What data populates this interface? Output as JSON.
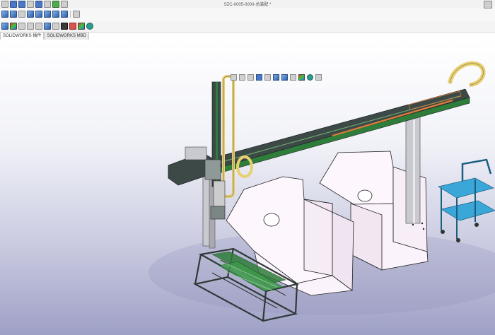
{
  "window": {
    "doc_title": "SZC-0005-0000-总装配 *"
  },
  "tabs": [
    {
      "label": "SOLIDWORKS 插件"
    },
    {
      "label": "SOLIDWORKS MBD"
    }
  ],
  "icons": {
    "quick_access": [
      "new-icon",
      "open-icon",
      "save-icon",
      "print-icon",
      "undo-icon",
      "select-icon",
      "rebuild-icon",
      "options-icon"
    ],
    "ribbon": [
      "view-orientation-icon",
      "shaded-icon",
      "wireframe-icon",
      "section-view-icon",
      "display-style-icon",
      "hide-show-icon",
      "edit-appearance-icon",
      "apply-scene-icon",
      "sketch-icon"
    ],
    "command_bar": [
      "appearance-icon",
      "rgb-icon",
      "lighting-icon",
      "camera-icon",
      "zoom-icon",
      "cube-icon",
      "section-icon",
      "dark-scene-icon",
      "decal-icon",
      "color-wheel-icon",
      "render-icon"
    ],
    "heads_up": [
      "zoom-to-fit-icon",
      "zoom-to-area-icon",
      "previous-view-icon",
      "section-view-icon",
      "dynamic-annotation-icon",
      "view-orientation-icon",
      "display-style-icon",
      "hide-show-items-icon",
      "edit-appearance-icon",
      "apply-scene-icon",
      "view-settings-icon"
    ]
  },
  "colors": {
    "part_white": "#fdf6fc",
    "frame_dark": "#2f3a38",
    "rail_green": "#2f7d3a",
    "cart_blue": "#3aa7d8",
    "hook_yellow": "#e8d070",
    "rail_orange": "#e07b39",
    "viewport_bottom": "#9ea0c6"
  }
}
